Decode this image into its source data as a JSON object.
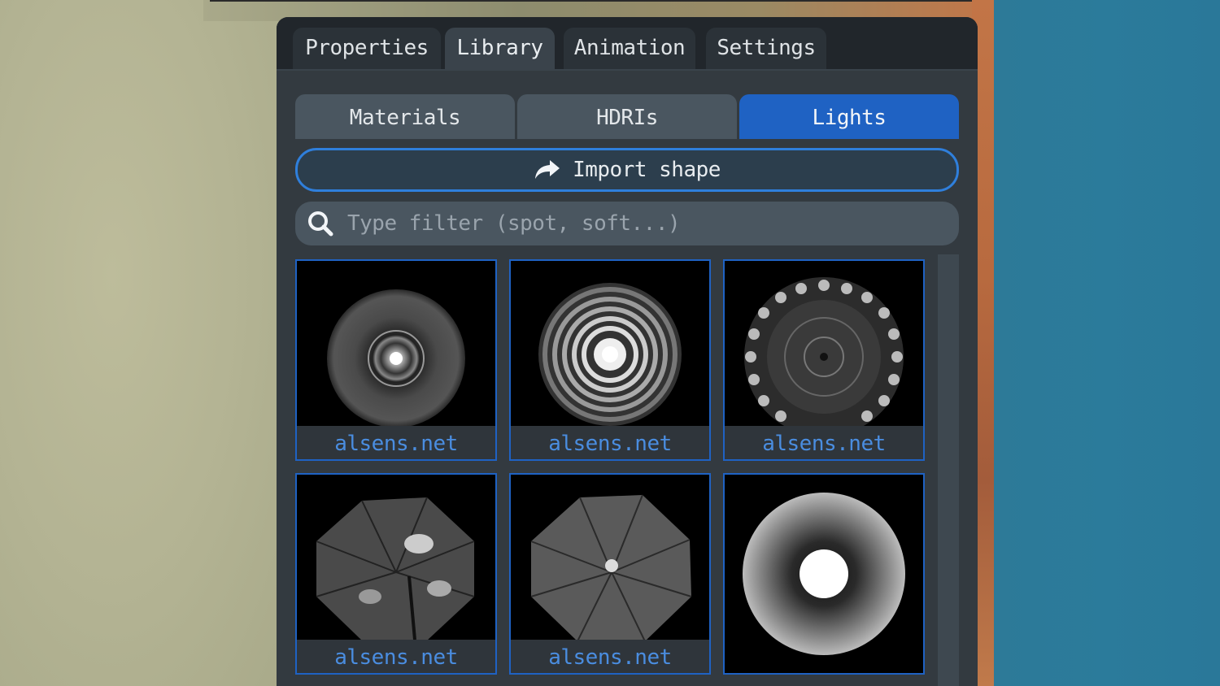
{
  "tabs": [
    {
      "label": "Properties"
    },
    {
      "label": "Library"
    },
    {
      "label": "Animation"
    },
    {
      "label": "Settings"
    }
  ],
  "subtabs": [
    {
      "label": "Materials"
    },
    {
      "label": "HDRIs"
    },
    {
      "label": "Lights"
    }
  ],
  "active_tab": "Library",
  "active_subtab": "Lights",
  "import_button": {
    "label": "Import shape",
    "icon": "share-arrow-icon"
  },
  "search": {
    "placeholder": "Type filter (spot, soft...)",
    "value": "",
    "icon": "search-icon"
  },
  "items": [
    {
      "caption": "alsens.net",
      "thumb": "round-reflector"
    },
    {
      "caption": "alsens.net",
      "thumb": "fresnel-spot"
    },
    {
      "caption": "alsens.net",
      "thumb": "beauty-dish-segmented"
    },
    {
      "caption": "alsens.net",
      "thumb": "umbrella-silver"
    },
    {
      "caption": "alsens.net",
      "thumb": "umbrella-grey"
    },
    {
      "caption": "",
      "thumb": "soft-disc-gradient"
    }
  ],
  "colors": {
    "accent": "#1f62c3",
    "accent_border": "#2f7fdc",
    "caption_text": "#4a8de0",
    "panel_bg": "#333a40",
    "tabbar_bg": "#21262b"
  }
}
